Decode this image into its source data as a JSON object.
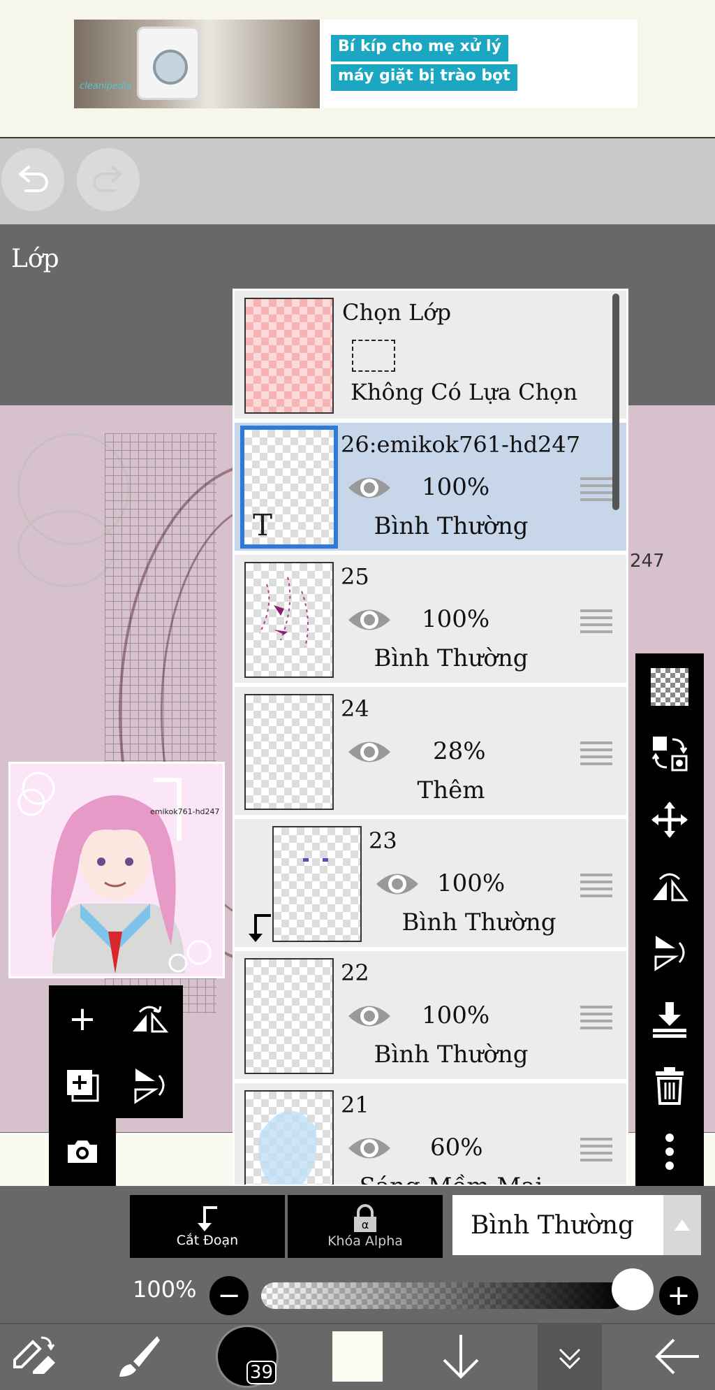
{
  "ad": {
    "line1": "Bí kíp cho mẹ xử lý",
    "line2": "máy giặt bị trào bọt",
    "brand": "cleanipedia"
  },
  "toolbar": {
    "undo_icon": "undo-icon",
    "redo_icon": "redo-icon"
  },
  "panel": {
    "title": "Lớp"
  },
  "selection_layer": {
    "title": "Chọn Lớp",
    "subtitle": "Không Có Lựa Chọn"
  },
  "layers": [
    {
      "name": "26:emikok761-hd247",
      "opacity": "100%",
      "mode": "Bình Thường",
      "selected": true,
      "type": "text",
      "type_label": "T"
    },
    {
      "name": "25",
      "opacity": "100%",
      "mode": "Bình Thường",
      "selected": false
    },
    {
      "name": "24",
      "opacity": "28%",
      "mode": "Thêm",
      "selected": false
    },
    {
      "name": "23",
      "opacity": "100%",
      "mode": "Bình Thường",
      "selected": false,
      "clipped": true
    },
    {
      "name": "22",
      "opacity": "100%",
      "mode": "Bình Thường",
      "selected": false
    },
    {
      "name": "21",
      "opacity": "60%",
      "mode": "Sáng Mềm Mại",
      "selected": false
    }
  ],
  "stray_text": "247",
  "preview": {
    "watermark": "emikok761-hd247"
  },
  "controls": {
    "clip_label": "Cắt Đoạn",
    "alpha_lock_label": "Khóa Alpha",
    "blend_mode": "Bình Thường",
    "opacity_label": "100%",
    "opacity_value": 100
  },
  "bottom_nav": {
    "brush_size": "39",
    "icons": [
      "swap-tool-icon",
      "brush-icon",
      "color-swatch",
      "layer-down-icon",
      "collapse-icon",
      "back-icon"
    ]
  },
  "colors": {
    "selected_layer": "#c8d6ea",
    "selected_border": "#2f7ad8",
    "ad_accent": "#1ba7c2"
  }
}
